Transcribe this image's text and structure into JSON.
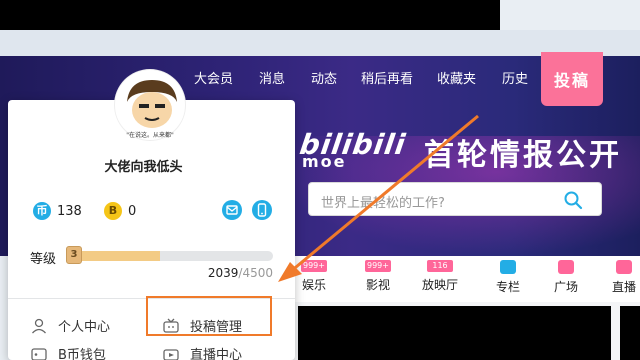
{
  "header": {
    "nav": [
      "大会员",
      "消息",
      "动态",
      "稍后再看",
      "收藏夹",
      "历史"
    ],
    "upload_label": "投稿"
  },
  "banner": {
    "logo_main": "bilibili",
    "logo_sub": "moe",
    "headline": "首轮情报公开"
  },
  "search": {
    "placeholder": "世界上最轻松的工作?"
  },
  "channels": [
    {
      "badge": "999+",
      "label": "娱乐",
      "color": "#f69"
    },
    {
      "badge": "999+",
      "label": "影视",
      "color": "#f69"
    },
    {
      "badge": "116",
      "label": "放映厅",
      "color": "#f69"
    },
    {
      "badge": "",
      "label": "专栏",
      "color": "#23ade5"
    },
    {
      "badge": "",
      "label": "广场",
      "color": "#f69"
    },
    {
      "badge": "",
      "label": "直播",
      "color": "#f69"
    }
  ],
  "user_popup": {
    "avatar_caption": "\"在说这。从来都\"",
    "username": "大佬向我低头",
    "coins": {
      "icon": "币",
      "value": "138"
    },
    "bcoin": {
      "icon": "B",
      "value": "0"
    },
    "level_label": "等级",
    "level": "3",
    "xp": {
      "current": "2039",
      "max": "/4500",
      "fraction": 0.453
    },
    "menu": [
      {
        "label": "个人中心",
        "icon": "person-icon"
      },
      {
        "label": "投稿管理",
        "icon": "tv-icon"
      },
      {
        "label": "B币钱包",
        "icon": "wallet-icon"
      },
      {
        "label": "直播中心",
        "icon": "live-icon"
      }
    ]
  },
  "colors": {
    "accent_pink": "#fb7299",
    "blue": "#23ade5",
    "highlight_orange": "#f07a2a"
  }
}
